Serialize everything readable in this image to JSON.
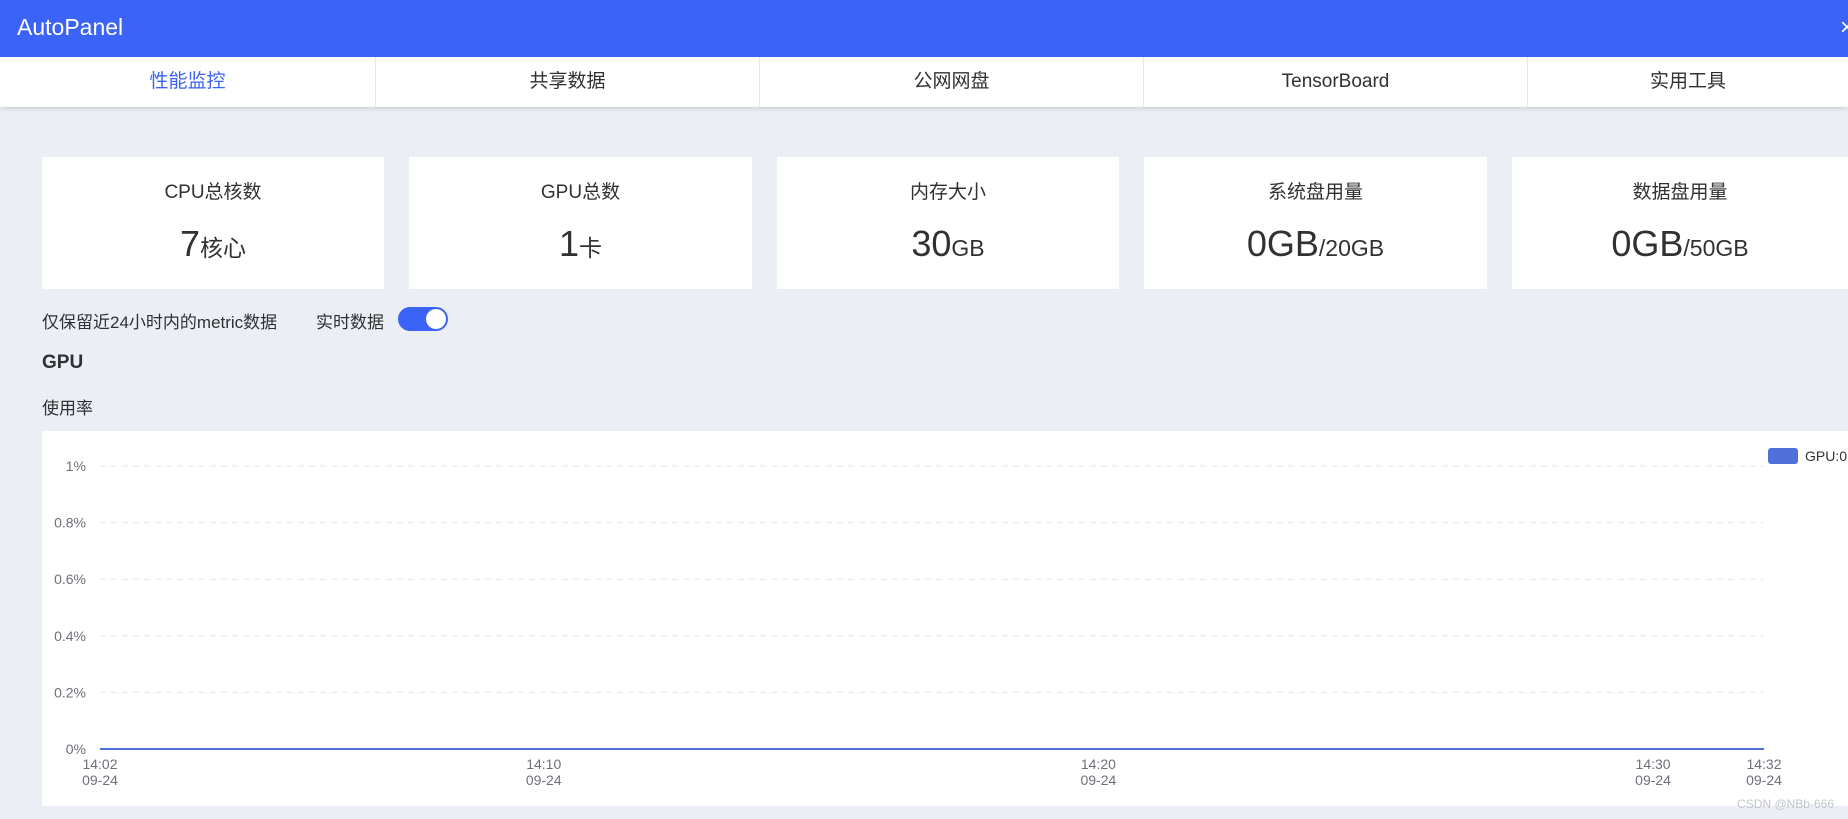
{
  "app": {
    "title": "AutoPanel",
    "close_glyph": "×"
  },
  "tabs": [
    {
      "label": "性能监控",
      "active": true
    },
    {
      "label": "共享数据",
      "active": false
    },
    {
      "label": "公网网盘",
      "active": false
    },
    {
      "label": "TensorBoard",
      "active": false
    },
    {
      "label": "实用工具",
      "active": false
    }
  ],
  "stats": [
    {
      "label": "CPU总核数",
      "value": "7",
      "unit": "核心"
    },
    {
      "label": "GPU总数",
      "value": "1",
      "unit": "卡"
    },
    {
      "label": "内存大小",
      "value": "30",
      "unit": "GB"
    },
    {
      "label": "系统盘用量",
      "value": "0GB",
      "unit": "/20GB"
    },
    {
      "label": "数据盘用量",
      "value": "0GB",
      "unit": "/50GB"
    }
  ],
  "controls": {
    "note": "仅保留近24小时内的metric数据",
    "realtime_label": "实时数据",
    "realtime_on": true
  },
  "section": {
    "title": "GPU",
    "subtitle": "使用率"
  },
  "colors": {
    "accent": "#3b63f5",
    "series": "#4f6fd9"
  },
  "chart_data": {
    "type": "line",
    "y_ticks": [
      "1%",
      "0.8%",
      "0.6%",
      "0.4%",
      "0.2%",
      "0%"
    ],
    "ylim": [
      0,
      1
    ],
    "x_ticks": [
      {
        "time": "14:02",
        "date": "09-24",
        "minute": 2
      },
      {
        "time": "14:10",
        "date": "09-24",
        "minute": 10
      },
      {
        "time": "14:20",
        "date": "09-24",
        "minute": 20
      },
      {
        "time": "14:30",
        "date": "09-24",
        "minute": 30
      },
      {
        "time": "14:32",
        "date": "09-24",
        "minute": 32
      }
    ],
    "xlim": [
      2,
      32
    ],
    "grid": true,
    "legend_position": "top-right",
    "series": [
      {
        "name": "GPU:0",
        "x": [
          2,
          10,
          20,
          30,
          32
        ],
        "values": [
          0,
          0,
          0,
          0,
          0
        ]
      }
    ]
  },
  "watermark": "CSDN @NBb-666"
}
